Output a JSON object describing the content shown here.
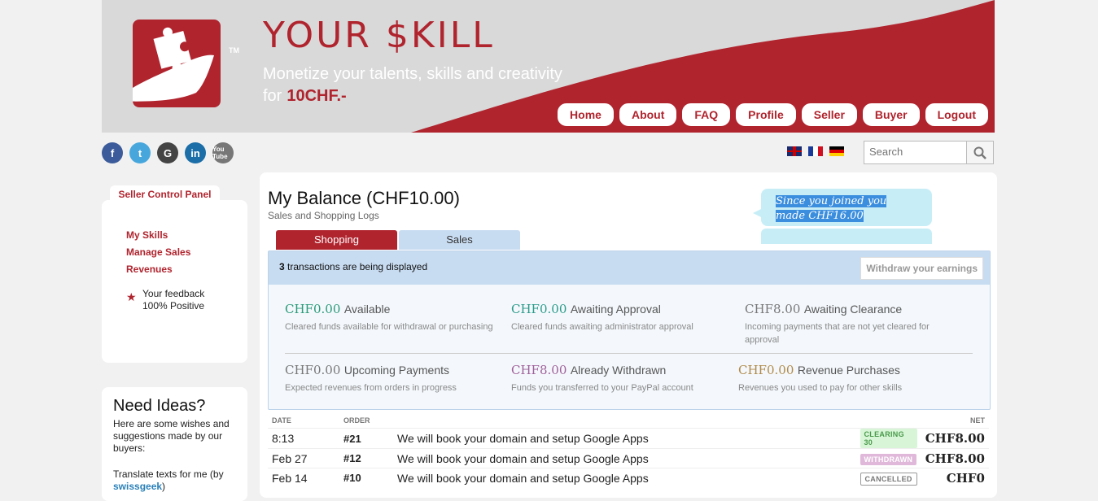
{
  "header": {
    "brand": "YOUR $KILL",
    "tm": "TM",
    "tagline_line1": "Monetize your talents, skills and creativity",
    "tagline_for": "for",
    "tagline_price": "10CHF.-",
    "nav": [
      "Home",
      "About",
      "FAQ",
      "Profile",
      "Seller",
      "Buyer",
      "Logout"
    ],
    "brand_color": "#b0242e"
  },
  "social": [
    "f",
    "t",
    "G",
    "in",
    "You Tube"
  ],
  "flags": [
    "uk-flag-icon",
    "fr-flag-icon",
    "de-flag-icon"
  ],
  "search": {
    "placeholder": "Search"
  },
  "sidebar": {
    "panel_title": "Seller Control Panel",
    "links": [
      "My Skills",
      "Manage Sales",
      "Revenues"
    ],
    "feedback_line1": "Your feedback",
    "feedback_line2": "100% Positive"
  },
  "ideas": {
    "title": "Need Ideas?",
    "text": "Here are some wishes and suggestions made by our buyers:",
    "wish": "Translate texts for me (by",
    "wish_user": "swissgeek",
    "wish_end": ")"
  },
  "main": {
    "title": "My Balance (CHF10.00)",
    "subtitle": "Sales and Shopping Logs",
    "bubble_line1": "Since you joined you",
    "bubble_line2": "made CHF16.00",
    "tabs": [
      "Shopping",
      "Sales"
    ],
    "count_text": "3 transactions are being displayed",
    "withdraw_label": "Withdraw your earnings",
    "stats": [
      {
        "amount": "CHF0.00",
        "label": "Available",
        "desc": "Cleared funds available for withdrawal or purchasing",
        "color": "#2a9a7a"
      },
      {
        "amount": "CHF0.00",
        "label": "Awaiting Approval",
        "desc": "Cleared funds awaiting administrator approval",
        "color": "#2a9a8a"
      },
      {
        "amount": "CHF8.00",
        "label": "Awaiting Clearance",
        "desc": "Incoming payments that are not yet cleared for approval",
        "color": "#777777"
      },
      {
        "amount": "CHF0.00",
        "label": "Upcoming Payments",
        "desc": "Expected revenues from orders in progress",
        "color": "#777777"
      },
      {
        "amount": "CHF8.00",
        "label": "Already Withdrawn",
        "desc": "Funds you transferred to your PayPal account",
        "color": "#a0609a"
      },
      {
        "amount": "CHF0.00",
        "label": "Revenue Purchases",
        "desc": "Revenues you used to pay for other skills",
        "color": "#b08a4a"
      }
    ],
    "table": {
      "headers": [
        "DATE",
        "ORDER",
        "",
        "NET"
      ],
      "rows": [
        {
          "date": "8:13",
          "order": "#21",
          "desc": "We will book your domain and setup Google Apps",
          "status": "CLEARING",
          "status_extra": "30",
          "net": "CHF8.00"
        },
        {
          "date": "Feb 27",
          "order": "#12",
          "desc": "We will book your domain and setup Google Apps",
          "status": "WITHDRAWN",
          "status_extra": "",
          "net": "CHF8.00"
        },
        {
          "date": "Feb 14",
          "order": "#10",
          "desc": "We will book your domain and setup Google Apps",
          "status": "CANCELLED",
          "status_extra": "",
          "net": "CHF0"
        }
      ]
    }
  }
}
